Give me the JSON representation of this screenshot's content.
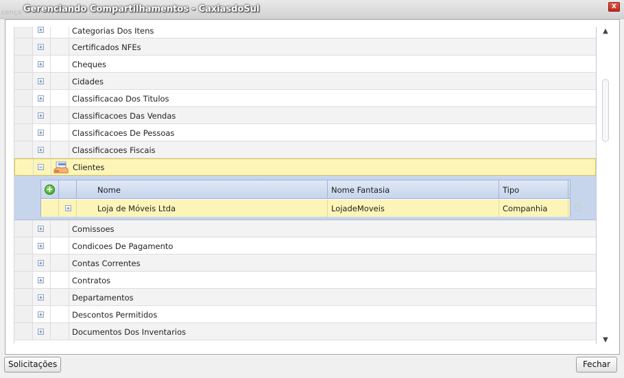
{
  "window": {
    "ghost_text": "cença",
    "title": "Gerenciando Compartilhamentos - CaxiasdoSul",
    "close_label": "X"
  },
  "grid": {
    "rows_before": [
      "Categorias Dos Itens",
      "Certificados NFEs",
      "Cheques",
      "Cidades",
      "Classificacao Dos Titulos",
      "Classificacoes Das Vendas",
      "Classificacoes De Pessoas",
      "Classificacoes Fiscais"
    ],
    "selected_row": "Clientes",
    "detail": {
      "headers": [
        "Nome",
        "Nome Fantasia",
        "Tipo"
      ],
      "rows": [
        {
          "nome": "Loja de Móveis Ltda",
          "fantasia": "LojadeMoveis",
          "tipo": "Companhia"
        }
      ]
    },
    "rows_after": [
      "Comissoes",
      "Condicoes De Pagamento",
      "Contas Correntes",
      "Contratos",
      "Departamentos",
      "Descontos Permitidos",
      "Documentos Dos Inventarios"
    ],
    "expand_glyph": "+",
    "collapse_glyph": "−"
  },
  "icons": {
    "folder": "folder-icon",
    "add": "add-icon",
    "delete": "delete-icon",
    "scroll_up": "▲",
    "scroll_down": "▼"
  },
  "footer": {
    "solicitacoes_label": "Solicitações",
    "fechar_label": "Fechar"
  }
}
